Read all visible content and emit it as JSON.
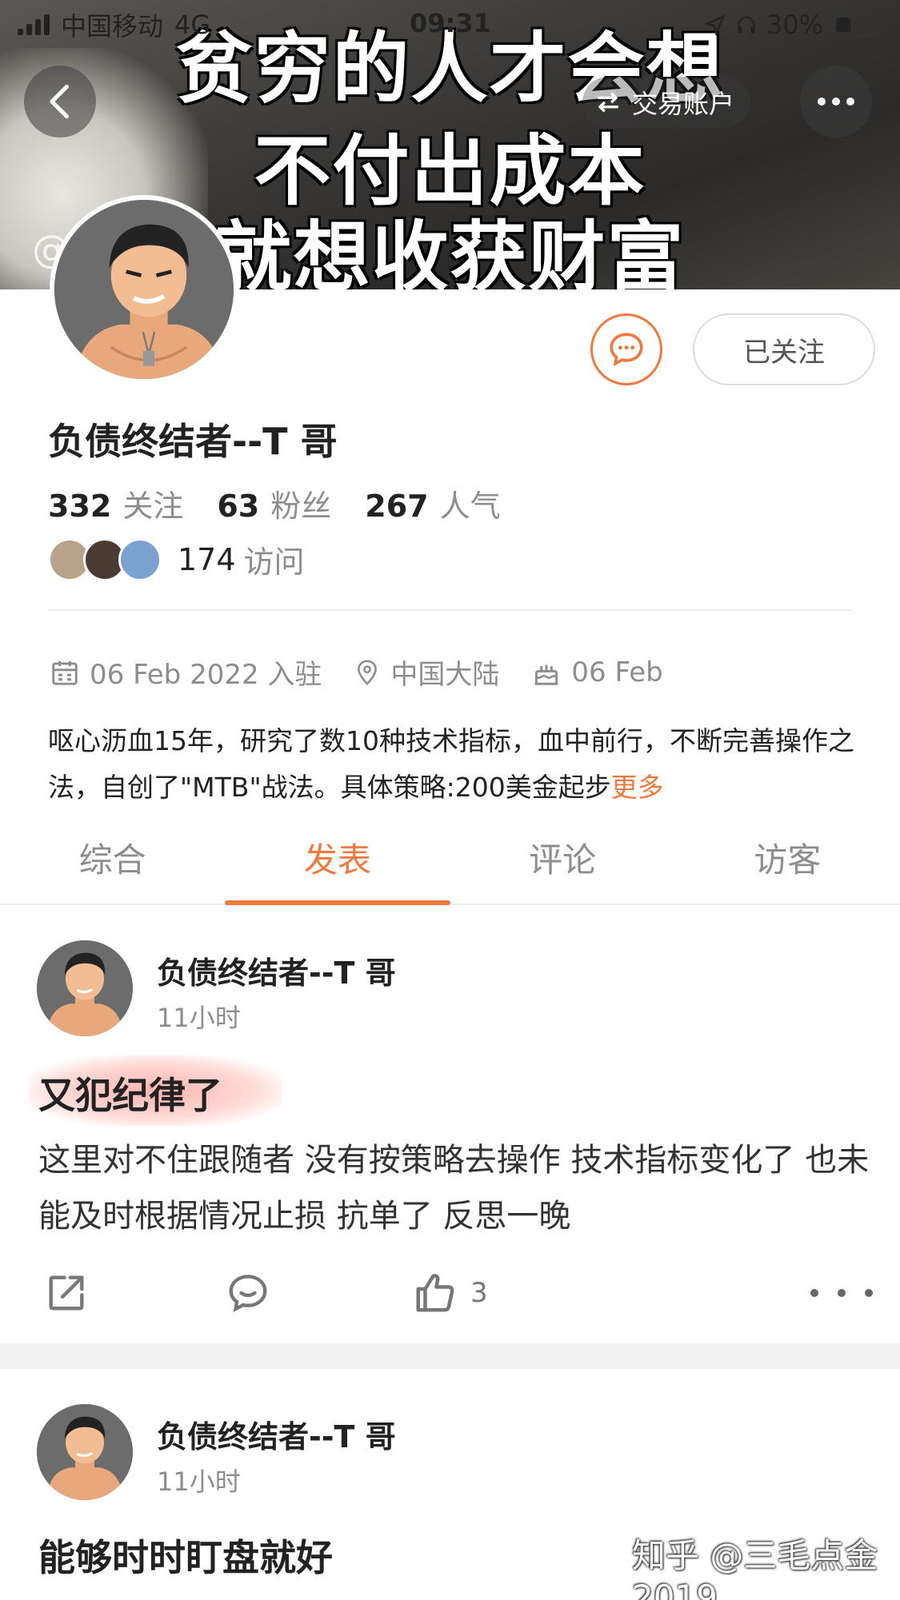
{
  "status_bar": {
    "carrier": "中国移动",
    "network": "4G",
    "time": "09:31",
    "battery": "30%"
  },
  "banner": {
    "lines": [
      "贫穷的人才会想",
      "不付出成本",
      "就想收获财富"
    ],
    "at_mark": "@"
  },
  "nav": {
    "trade_label": "交易账户"
  },
  "profile": {
    "name": "负债终结者--T 哥",
    "follow_label": "已关注",
    "stats": [
      {
        "num": "332",
        "label": "关注"
      },
      {
        "num": "63",
        "label": "粉丝"
      },
      {
        "num": "267",
        "label": "人气"
      }
    ],
    "visits": {
      "num": "174",
      "label": "访问"
    },
    "visitor_colors": [
      "#b9a38d",
      "#4a3b33",
      "#7aa2d0"
    ],
    "joined": "06 Feb 2022 入驻",
    "location": "中国大陆",
    "birthday": "06 Feb",
    "bio": "呕心沥血15年，研究了数10种技术指标，血中前行，不断完善操作之法，自创了\"MTB\"战法。具体策略:200美金起步",
    "bio_more": "更多"
  },
  "tabs": [
    {
      "label": "综合",
      "active": false
    },
    {
      "label": "发表",
      "active": true
    },
    {
      "label": "评论",
      "active": false
    },
    {
      "label": "访客",
      "active": false
    }
  ],
  "posts": [
    {
      "author": "负债终结者--T 哥",
      "time": "11小时",
      "title": "又犯纪律了",
      "body": "这里对不住跟随者 没有按策略去操作 技术指标变化了 也未能及时根据情况止损 抗单了 反思一晚",
      "likes": "3"
    },
    {
      "author": "负债终结者--T 哥",
      "time": "11小时",
      "title": "能够时时盯盘就好"
    }
  ],
  "watermark": "知乎 @三毛点金2019",
  "colors": {
    "accent": "#f07a3e",
    "text": "#222222",
    "muted": "#8d8d8d"
  }
}
